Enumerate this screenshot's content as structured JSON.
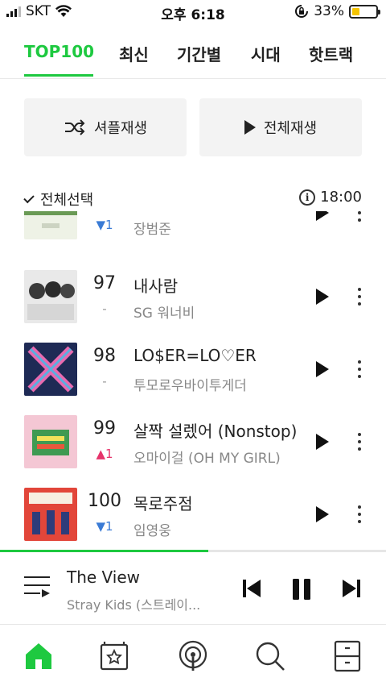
{
  "status": {
    "carrier": "SKT",
    "time": "오후 6:18",
    "battery": "33%",
    "battery_level": 0.33,
    "battery_color": "#f5c400"
  },
  "tabs": [
    {
      "label": "TOP100",
      "active": true
    },
    {
      "label": "최신",
      "active": false
    },
    {
      "label": "기간별",
      "active": false
    },
    {
      "label": "시대",
      "active": false
    },
    {
      "label": "핫트랙",
      "active": false
    }
  ],
  "actions": {
    "shuffle_label": "셔플재생",
    "play_all_label": "전체재생"
  },
  "list_header": {
    "select_all_label": "전체선택",
    "updated_time": "18:00"
  },
  "songs": [
    {
      "rank": "",
      "change": "▼1",
      "change_dir": "down",
      "title": "",
      "artist": "장범준"
    },
    {
      "rank": "97",
      "change": "-",
      "change_dir": "same",
      "title": "내사람",
      "artist": "SG 워너비"
    },
    {
      "rank": "98",
      "change": "-",
      "change_dir": "same",
      "title": "LO$ER=LO♡ER",
      "artist": "투모로우바이투게더"
    },
    {
      "rank": "99",
      "change": "▲1",
      "change_dir": "up",
      "title": "살짝 설렜어 (Nonstop)",
      "artist": "오마이걸 (OH MY GIRL)"
    },
    {
      "rank": "100",
      "change": "▼1",
      "change_dir": "down",
      "title": "목로주점",
      "artist": "임영웅"
    }
  ],
  "player": {
    "title": "The View",
    "artist": "Stray Kids (스트레이...",
    "progress": 0.54
  },
  "nav": [
    "home-icon",
    "playlist-star-icon",
    "podcast-icon",
    "search-icon",
    "storage-icon"
  ],
  "colors": {
    "accent": "#1ec940",
    "rank_down": "#3a7bd5",
    "rank_up": "#e6336b"
  }
}
